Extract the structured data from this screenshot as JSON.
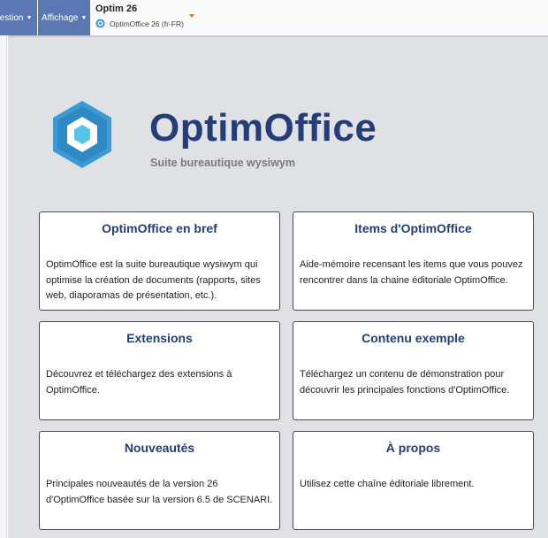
{
  "toolbar": {
    "gestion_label": "Gestion",
    "affichage_label": "Affichage"
  },
  "workspace": {
    "title": "Optim 26",
    "subtitle": "OptimOffice 26 (fr-FR)",
    "icon": "optim-hexagon-icon"
  },
  "hero": {
    "title": "OptimOffice",
    "subtitle": "Suite bureautique wysiwym",
    "logo": "hexagon-logo"
  },
  "cards": [
    {
      "title": "OptimOffice en bref",
      "text": "OptimOffice est la suite bureautique wysiwym qui optimise la création de documents (rapports, sites web, diaporamas de présentation, etc.)."
    },
    {
      "title": "Items d'OptimOffice",
      "text": "Aide-mémoire recensant les items que vous pouvez rencontrer dans la chaine éditoriale OptimOffice."
    },
    {
      "title": "Extensions",
      "text": "Découvrez et téléchargez des extensions à OptimOffice."
    },
    {
      "title": "Contenu exemple",
      "text": "Téléchargez un contenu de démonstration pour découvrir les principales fonctions d'OptimOffice."
    },
    {
      "title": "Nouveautés",
      "text": "Principales nouveautés de la version 26 d'OptimOffice basée sur la version 6.5 de SCENARI."
    },
    {
      "title": "À propos",
      "text": "Utilisez cette chaîne éditoriale librement."
    }
  ],
  "colors": {
    "menu_bg": "#5a79b4",
    "accent": "#243d78",
    "logo_outer": "#3a9bd5",
    "logo_inner": "#55c3ea",
    "caret": "#d07a2c"
  }
}
